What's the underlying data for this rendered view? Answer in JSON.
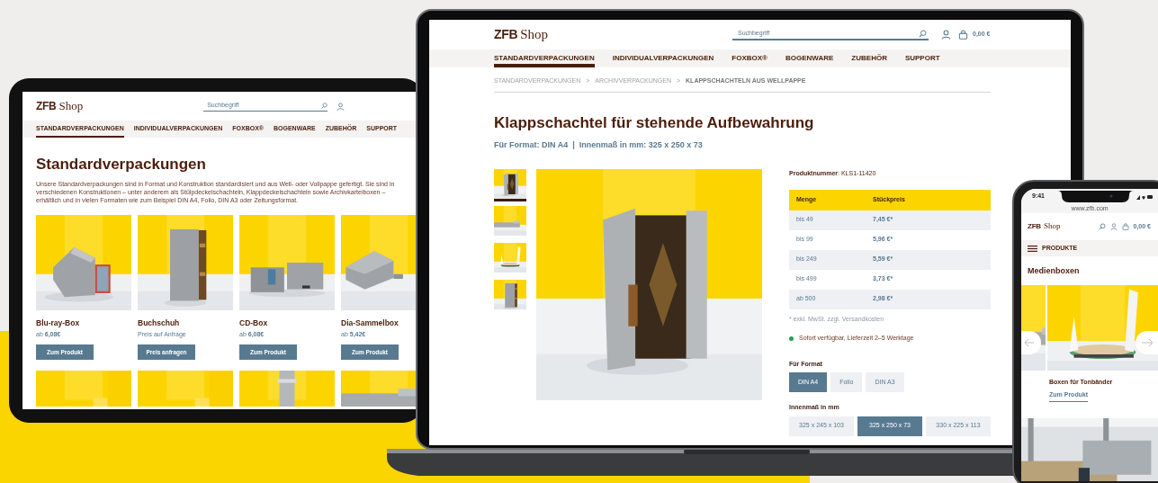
{
  "tablet": {
    "logo": {
      "mark": "ZFB",
      "word": "Shop"
    },
    "search": {
      "placeholder": "Suchbegriff"
    },
    "nav": [
      {
        "label": "STANDARDVERPACKUNGEN",
        "selected": true
      },
      {
        "label": "INDIVIDUALVERPACKUNGEN",
        "selected": false
      },
      {
        "label": "FOXBOX®",
        "selected": false
      },
      {
        "label": "BOGENWARE",
        "selected": false
      },
      {
        "label": "ZUBEHÖR",
        "selected": false
      },
      {
        "label": "SUPPORT",
        "selected": false
      }
    ],
    "heading": "Standardverpackungen",
    "intro": "Unsere Standardverpackungen sind in Format und Konstruktion standardisiert und aus Well- oder Vollpappe gefertigt. Sie sind in verschiedenen Konstruktionen – unter anderem als Stülpdeckelschachteln, Klappdeckelschachteln sowie Archivkarteiboxen – erhältlich und in vielen Formaten wie zum Beispiel DIN A4, Folio, DIN A3 oder Zeitungsformat.",
    "products": [
      {
        "name": "Blu-ray-Box",
        "price": "ab **6,08€**",
        "button": "Zum Produkt"
      },
      {
        "name": "Buchschuh",
        "price": "Preis auf Anfrage",
        "button": "Preis anfragen"
      },
      {
        "name": "CD-Box",
        "price": "ab **6,08€**",
        "button": "Zum Produkt"
      },
      {
        "name": "Dia-Sammelbox",
        "price": "ab **5,42€**",
        "button": "Zum Produkt"
      }
    ]
  },
  "laptop": {
    "logo": {
      "mark": "ZFB",
      "word": "Shop"
    },
    "search": {
      "placeholder": "Suchbegriff"
    },
    "cart_total": "0,00 €",
    "nav": [
      {
        "label": "STANDARDVERPACKUNGEN",
        "selected": true
      },
      {
        "label": "INDIVIDUALVERPACKUNGEN",
        "selected": false
      },
      {
        "label": "FOXBOX®",
        "selected": false
      },
      {
        "label": "BOGENWARE",
        "selected": false
      },
      {
        "label": "ZUBEHÖR",
        "selected": false
      },
      {
        "label": "SUPPORT",
        "selected": false
      }
    ],
    "breadcrumbs": [
      {
        "label": "STANDARDVERPACKUNGEN",
        "current": false
      },
      {
        "label": "ARCHIVVERPACKUNGEN",
        "current": false
      },
      {
        "label": "KLAPPSCHACHTELN AUS WELLPAPPE",
        "current": true
      }
    ],
    "breadcrumb_separator": ">",
    "title": "Klappschachtel für stehende Aufbewahrung",
    "subtitle": "Für Format: DIN A4  |  Innenmaß in mm: 325 x 250 x 73",
    "thumbnails": [
      {
        "selected": true
      },
      {
        "selected": false
      },
      {
        "selected": false
      },
      {
        "selected": false
      }
    ],
    "product_number": "**Produktnummer**: KLS1-11420",
    "price_table": {
      "columns": [
        "Menge",
        "Stückpreis"
      ],
      "rows": [
        [
          "bis 49",
          "7,45 €*"
        ],
        [
          "bis 99",
          "5,96 €*"
        ],
        [
          "bis 249",
          "5,59 €*"
        ],
        [
          "bis 499",
          "3,73 €*"
        ],
        [
          "ab 500",
          "2,98 €*"
        ]
      ]
    },
    "footnote": "* exkl. MwSt. zzgl. Versandkosten",
    "availability": {
      "text": "Sofort verfügbar, Lieferzeit 2–5 Werktage",
      "color": "#1fa34a"
    },
    "options": [
      {
        "label": "Für Format",
        "values": [
          {
            "label": "DIN A4",
            "selected": true
          },
          {
            "label": "Folio",
            "selected": false
          },
          {
            "label": "DIN A3",
            "selected": false
          }
        ]
      },
      {
        "label": "Innenmaß in mm",
        "values": [
          {
            "label": "325 x 245 x 103",
            "selected": false
          },
          {
            "label": "325 x 250 x 73",
            "selected": true
          },
          {
            "label": "330 x 225 x 113",
            "selected": false
          }
        ]
      }
    ]
  },
  "phone": {
    "time": "9:41",
    "url": "www.zfb.com",
    "logo": {
      "mark": "ZFB",
      "word": "Shop"
    },
    "cart_total": "0,00 €",
    "menu": "PRODUKTE",
    "heading": "Medienboxen",
    "product": {
      "name": "Boxen für Tonbänder",
      "link": "Zum Produkt"
    }
  }
}
